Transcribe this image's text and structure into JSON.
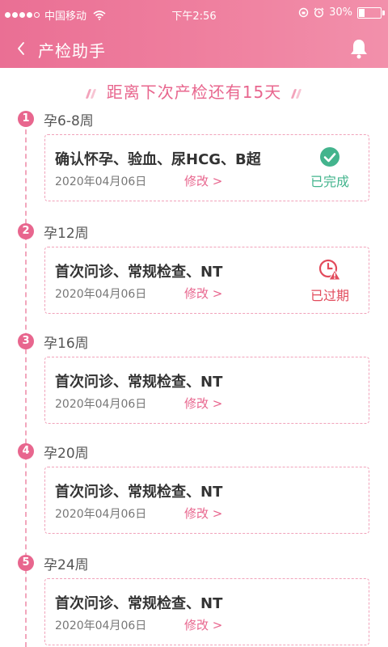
{
  "status_bar": {
    "carrier": "中国移动",
    "time": "下午2:56",
    "battery": "30%",
    "battery_level": 0.3
  },
  "header": {
    "title": "产检助手",
    "back_icon": "chevron-left-icon",
    "bell_icon": "bell-icon"
  },
  "countdown": "距离下次产检还有15天",
  "colors": {
    "accent": "#e8668e",
    "done": "#43b48d",
    "overdue": "#e24b5c"
  },
  "steps": [
    {
      "num": "1",
      "week": "孕6-8周",
      "title": "确认怀孕、验血、尿HCG、B超",
      "date": "2020年04月06日",
      "edit": "修改",
      "status": "已完成",
      "status_icon": "check-circle-icon"
    },
    {
      "num": "2",
      "week": "孕12周",
      "title": "首次问诊、常规检查、NT",
      "date": "2020年04月06日",
      "edit": "修改",
      "status": "已过期",
      "status_icon": "clock-warning-icon"
    },
    {
      "num": "3",
      "week": "孕16周",
      "title": "首次问诊、常规检查、NT",
      "date": "2020年04月06日",
      "edit": "修改"
    },
    {
      "num": "4",
      "week": "孕20周",
      "title": "首次问诊、常规检查、NT",
      "date": "2020年04月06日",
      "edit": "修改"
    },
    {
      "num": "5",
      "week": "孕24周",
      "title": "首次问诊、常规检查、NT",
      "date": "2020年04月06日",
      "edit": "修改"
    }
  ]
}
